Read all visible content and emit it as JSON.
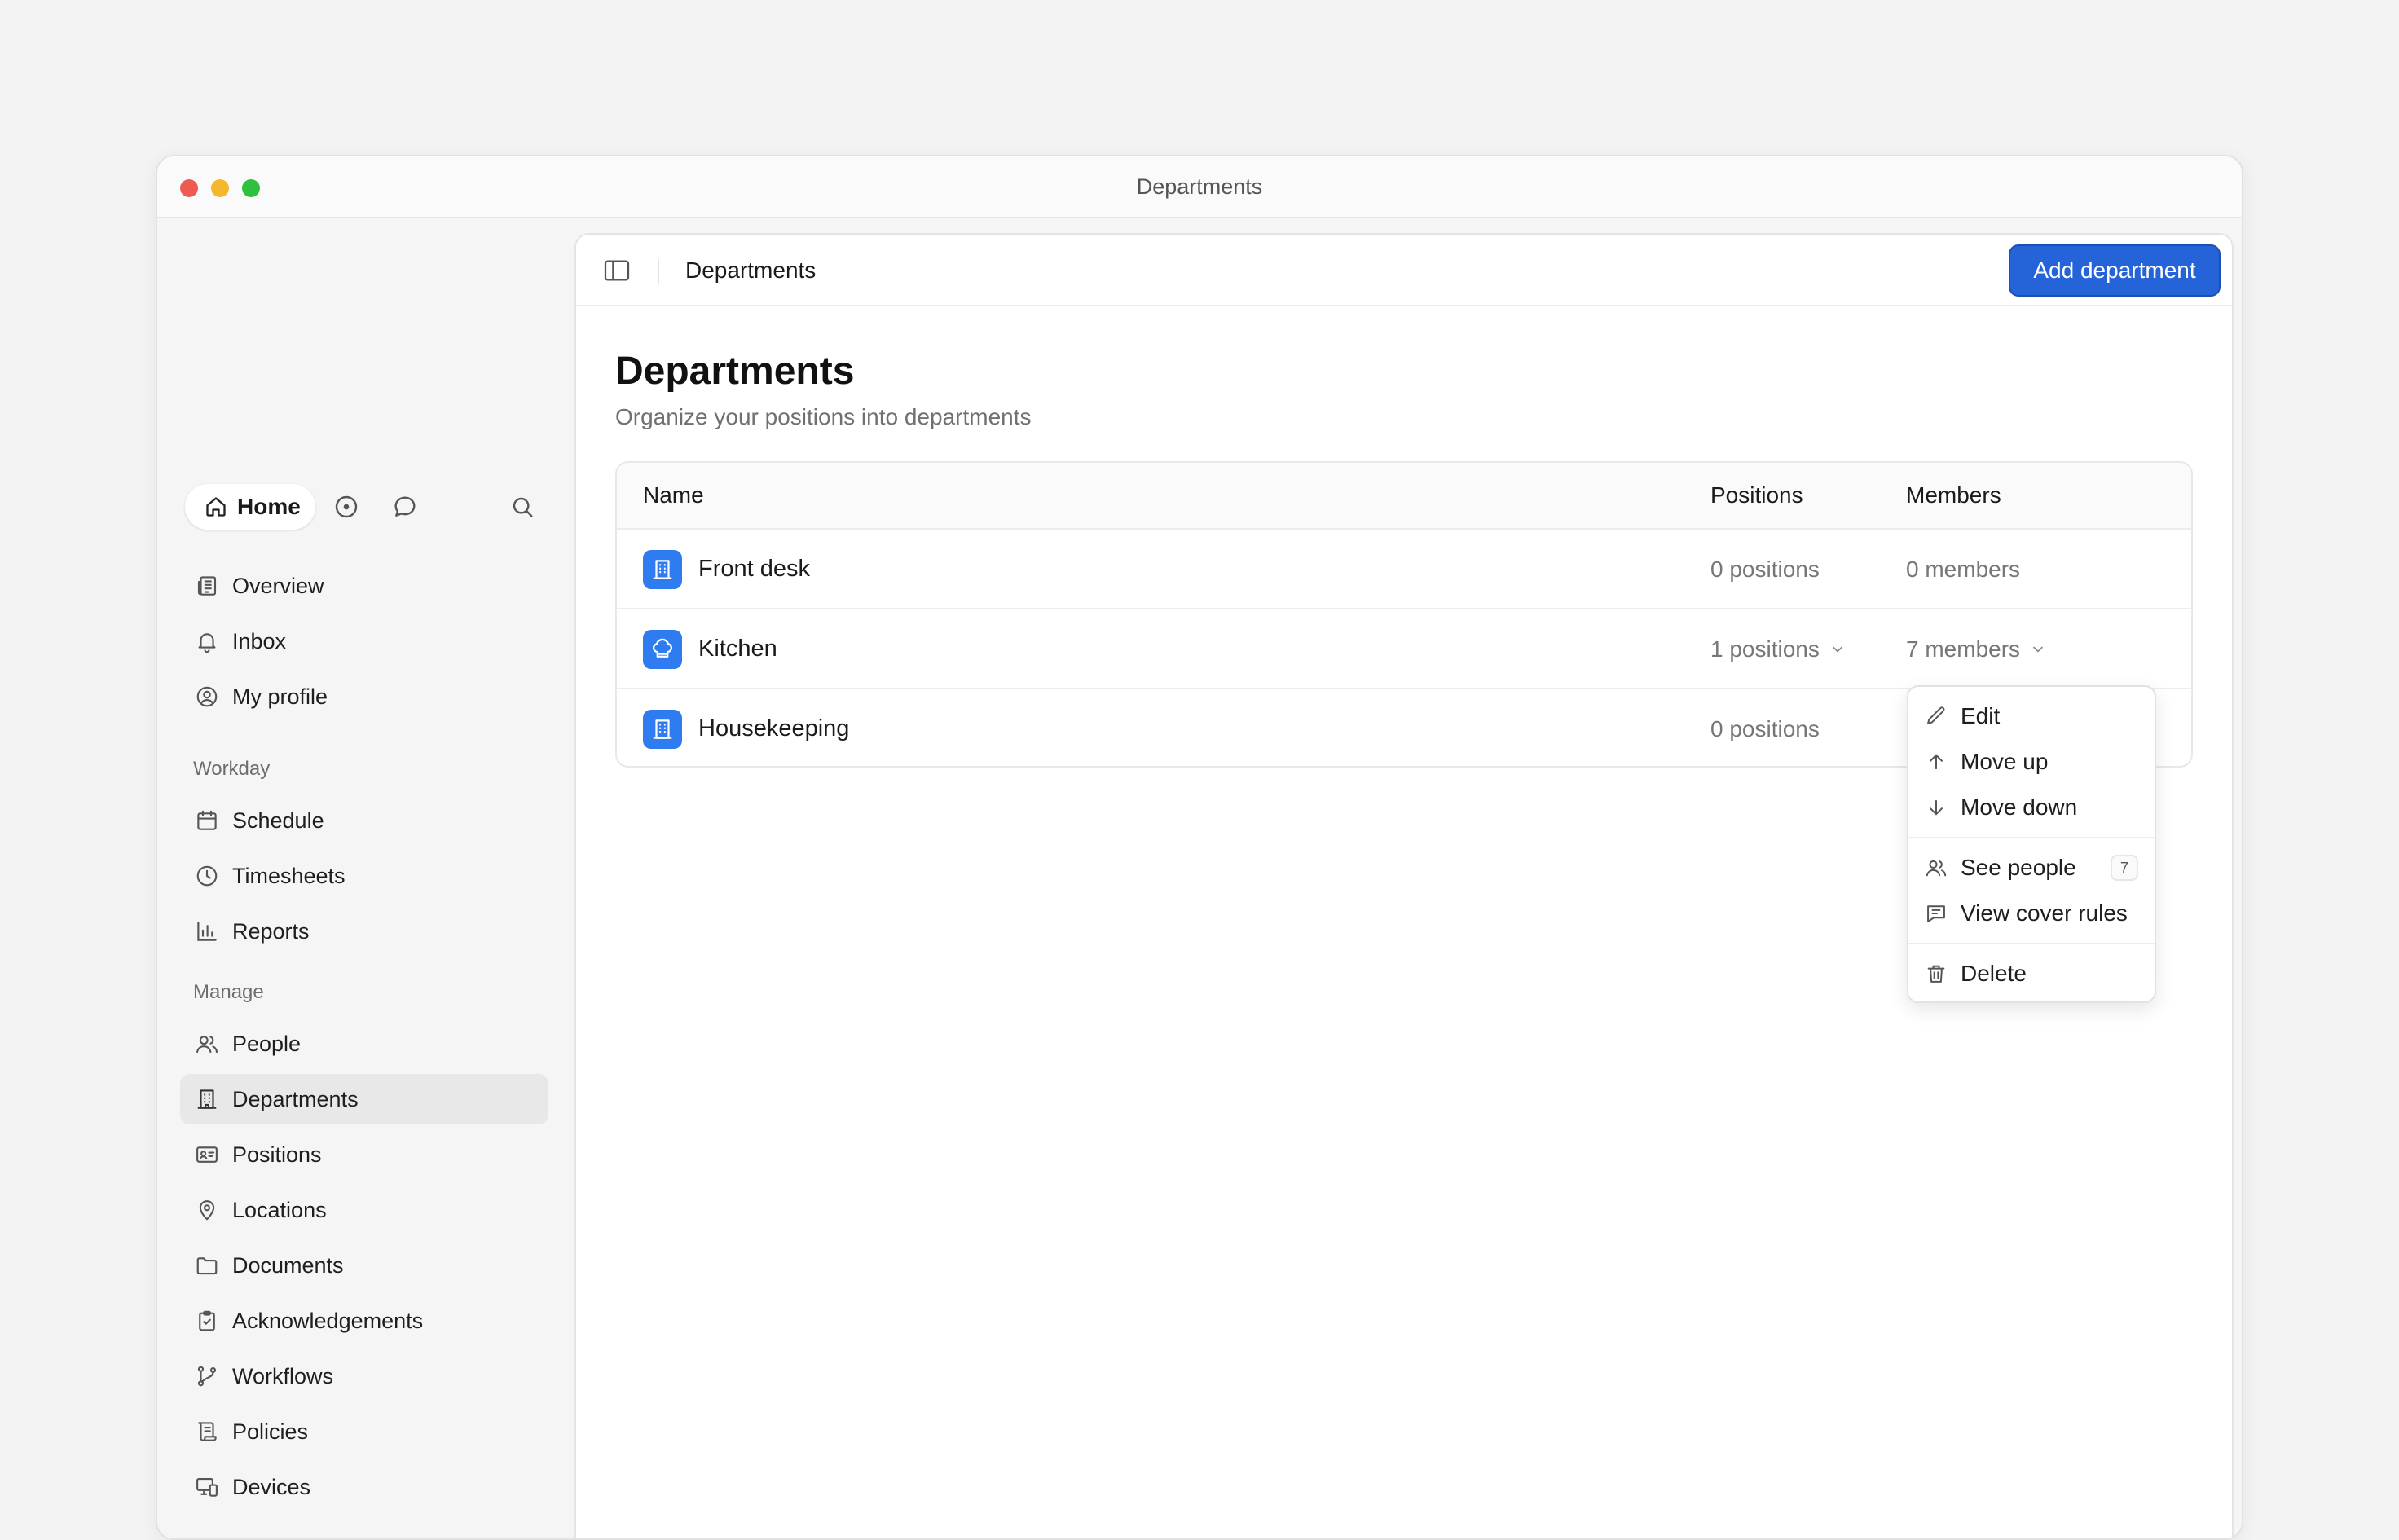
{
  "window": {
    "title": "Departments"
  },
  "topnav": {
    "home_label": "Home"
  },
  "sidebar": {
    "items_top": [
      {
        "label": "Overview",
        "icon": "newspaper-icon"
      },
      {
        "label": "Inbox",
        "icon": "bell-icon"
      },
      {
        "label": "My profile",
        "icon": "user-circle-icon"
      }
    ],
    "section_workday": "Workday",
    "items_workday": [
      {
        "label": "Schedule",
        "icon": "calendar-icon"
      },
      {
        "label": "Timesheets",
        "icon": "clock-icon"
      },
      {
        "label": "Reports",
        "icon": "bar-chart-icon"
      }
    ],
    "section_manage": "Manage",
    "items_manage": [
      {
        "label": "People",
        "icon": "users-icon"
      },
      {
        "label": "Departments",
        "icon": "building-icon",
        "active": true
      },
      {
        "label": "Positions",
        "icon": "id-card-icon"
      },
      {
        "label": "Locations",
        "icon": "map-pin-icon"
      },
      {
        "label": "Documents",
        "icon": "folder-icon"
      },
      {
        "label": "Acknowledgements",
        "icon": "clipboard-check-icon"
      },
      {
        "label": "Workflows",
        "icon": "git-branch-icon"
      },
      {
        "label": "Policies",
        "icon": "scroll-icon"
      },
      {
        "label": "Devices",
        "icon": "devices-icon"
      }
    ]
  },
  "topbar": {
    "breadcrumb": "Departments",
    "add_button": "Add department"
  },
  "page": {
    "title": "Departments",
    "subtitle": "Organize your positions into departments"
  },
  "table": {
    "columns": [
      "Name",
      "Positions",
      "Members"
    ],
    "rows": [
      {
        "name": "Front desk",
        "icon": "building-icon",
        "positions": "0 positions",
        "members": "0 members",
        "positions_dropdown": false,
        "members_dropdown": false
      },
      {
        "name": "Kitchen",
        "icon": "chef-hat-icon",
        "positions": "1 positions",
        "members": "7 members",
        "positions_dropdown": true,
        "members_dropdown": true
      },
      {
        "name": "Housekeeping",
        "icon": "building-icon",
        "positions": "0 positions",
        "members": "",
        "positions_dropdown": false,
        "members_dropdown": false
      }
    ]
  },
  "menu": {
    "items": [
      {
        "label": "Edit",
        "icon": "pencil-icon"
      },
      {
        "label": "Move up",
        "icon": "arrow-up-icon"
      },
      {
        "label": "Move down",
        "icon": "arrow-down-icon"
      },
      {
        "label": "See people",
        "icon": "users-icon",
        "badge": "7"
      },
      {
        "label": "View cover rules",
        "icon": "message-square-text-icon"
      },
      {
        "label": "Delete",
        "icon": "trash-icon"
      }
    ]
  },
  "colors": {
    "accent": "#2563d8",
    "dept_icon_bg": "#2f7cf0",
    "active_item_bg": "#e8e8e8"
  }
}
